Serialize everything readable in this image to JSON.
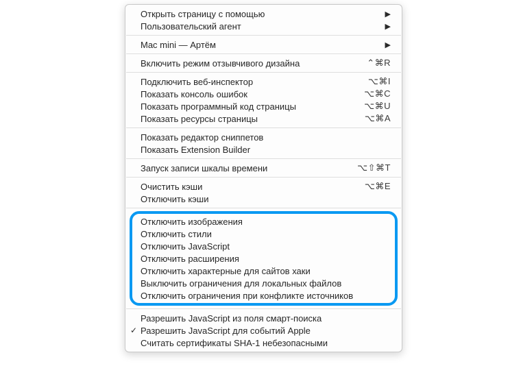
{
  "menu": {
    "group1": [
      {
        "label": "Открыть страницу с помощью",
        "submenu": true
      },
      {
        "label": "Пользовательский агент",
        "submenu": true
      }
    ],
    "group2": [
      {
        "label": "Mac mini — Артём",
        "submenu": true
      }
    ],
    "group3": [
      {
        "label": "Включить режим отзывчивого дизайна",
        "shortcut": "⌃⌘R"
      }
    ],
    "group4": [
      {
        "label": "Подключить веб-инспектор",
        "shortcut": "⌥⌘I"
      },
      {
        "label": "Показать консоль ошибок",
        "shortcut": "⌥⌘C"
      },
      {
        "label": "Показать программный код страницы",
        "shortcut": "⌥⌘U"
      },
      {
        "label": "Показать ресурсы страницы",
        "shortcut": "⌥⌘A"
      }
    ],
    "group5": [
      {
        "label": "Показать редактор сниппетов"
      },
      {
        "label": "Показать Extension Builder"
      }
    ],
    "group6": [
      {
        "label": "Запуск записи шкалы времени",
        "shortcut": "⌥⇧⌘T"
      }
    ],
    "group7": [
      {
        "label": "Очистить кэши",
        "shortcut": "⌥⌘E"
      },
      {
        "label": "Отключить кэши"
      }
    ],
    "highlight": [
      {
        "label": "Отключить изображения"
      },
      {
        "label": "Отключить стили"
      },
      {
        "label": "Отключить JavaScript"
      },
      {
        "label": "Отключить расширения"
      },
      {
        "label": "Отключить характерные для сайтов хаки"
      },
      {
        "label": "Выключить ограничения для локальных файлов"
      },
      {
        "label": "Отключить ограничения при конфликте источников"
      }
    ],
    "group9": [
      {
        "label": "Разрешить JavaScript из поля смарт-поиска"
      },
      {
        "label": "Разрешить JavaScript для событий Apple",
        "checked": true
      },
      {
        "label": "Считать сертификаты SHA-1 небезопасными"
      }
    ]
  }
}
